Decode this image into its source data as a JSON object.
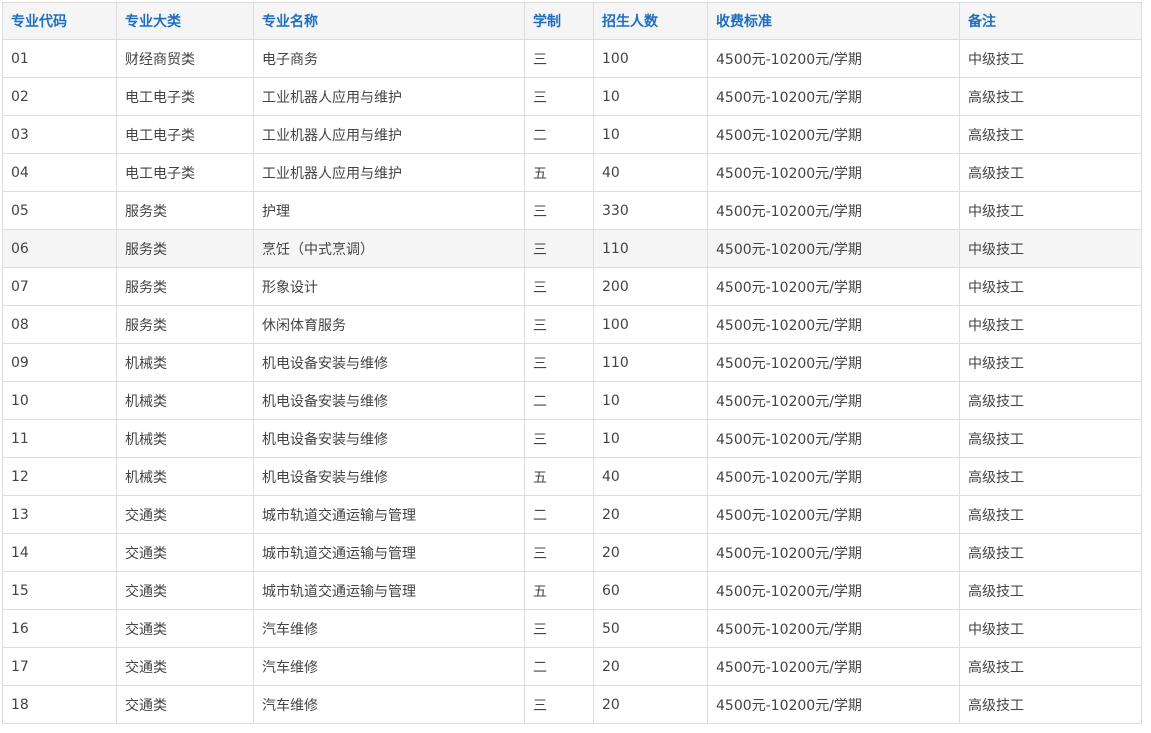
{
  "table": {
    "headers": [
      "专业代码",
      "专业大类",
      "专业名称",
      "学制",
      "招生人数",
      "收费标准",
      "备注"
    ],
    "rows": [
      [
        "01",
        "财经商贸类",
        "电子商务",
        "三",
        "100",
        "4500元-10200元/学期",
        "中级技工"
      ],
      [
        "02",
        "电工电子类",
        "工业机器人应用与维护",
        "三",
        "10",
        "4500元-10200元/学期",
        "高级技工"
      ],
      [
        "03",
        "电工电子类",
        "工业机器人应用与维护",
        "二",
        "10",
        "4500元-10200元/学期",
        "高级技工"
      ],
      [
        "04",
        "电工电子类",
        "工业机器人应用与维护",
        "五",
        "40",
        "4500元-10200元/学期",
        "高级技工"
      ],
      [
        "05",
        "服务类",
        "护理",
        "三",
        "330",
        "4500元-10200元/学期",
        "中级技工"
      ],
      [
        "06",
        "服务类",
        "烹饪（中式烹调）",
        "三",
        "110",
        "4500元-10200元/学期",
        "中级技工"
      ],
      [
        "07",
        "服务类",
        "形象设计",
        "三",
        "200",
        "4500元-10200元/学期",
        "中级技工"
      ],
      [
        "08",
        "服务类",
        "休闲体育服务",
        "三",
        "100",
        "4500元-10200元/学期",
        "中级技工"
      ],
      [
        "09",
        "机械类",
        "机电设备安装与维修",
        "三",
        "110",
        "4500元-10200元/学期",
        "中级技工"
      ],
      [
        "10",
        "机械类",
        "机电设备安装与维修",
        "二",
        "10",
        "4500元-10200元/学期",
        "高级技工"
      ],
      [
        "11",
        "机械类",
        "机电设备安装与维修",
        "三",
        "10",
        "4500元-10200元/学期",
        "高级技工"
      ],
      [
        "12",
        "机械类",
        "机电设备安装与维修",
        "五",
        "40",
        "4500元-10200元/学期",
        "高级技工"
      ],
      [
        "13",
        "交通类",
        "城市轨道交通运输与管理",
        "二",
        "20",
        "4500元-10200元/学期",
        "高级技工"
      ],
      [
        "14",
        "交通类",
        "城市轨道交通运输与管理",
        "三",
        "20",
        "4500元-10200元/学期",
        "高级技工"
      ],
      [
        "15",
        "交通类",
        "城市轨道交通运输与管理",
        "五",
        "60",
        "4500元-10200元/学期",
        "高级技工"
      ],
      [
        "16",
        "交通类",
        "汽车维修",
        "三",
        "50",
        "4500元-10200元/学期",
        "中级技工"
      ],
      [
        "17",
        "交通类",
        "汽车维修",
        "二",
        "20",
        "4500元-10200元/学期",
        "高级技工"
      ],
      [
        "18",
        "交通类",
        "汽车维修",
        "三",
        "20",
        "4500元-10200元/学期",
        "高级技工"
      ]
    ]
  },
  "colors": {
    "header_text": "#1e6fbf",
    "header_bg": "#f5f5f5",
    "highlight_row_bg": "#f5f5f5",
    "border": "#dddddd",
    "cell_text": "#444444"
  }
}
